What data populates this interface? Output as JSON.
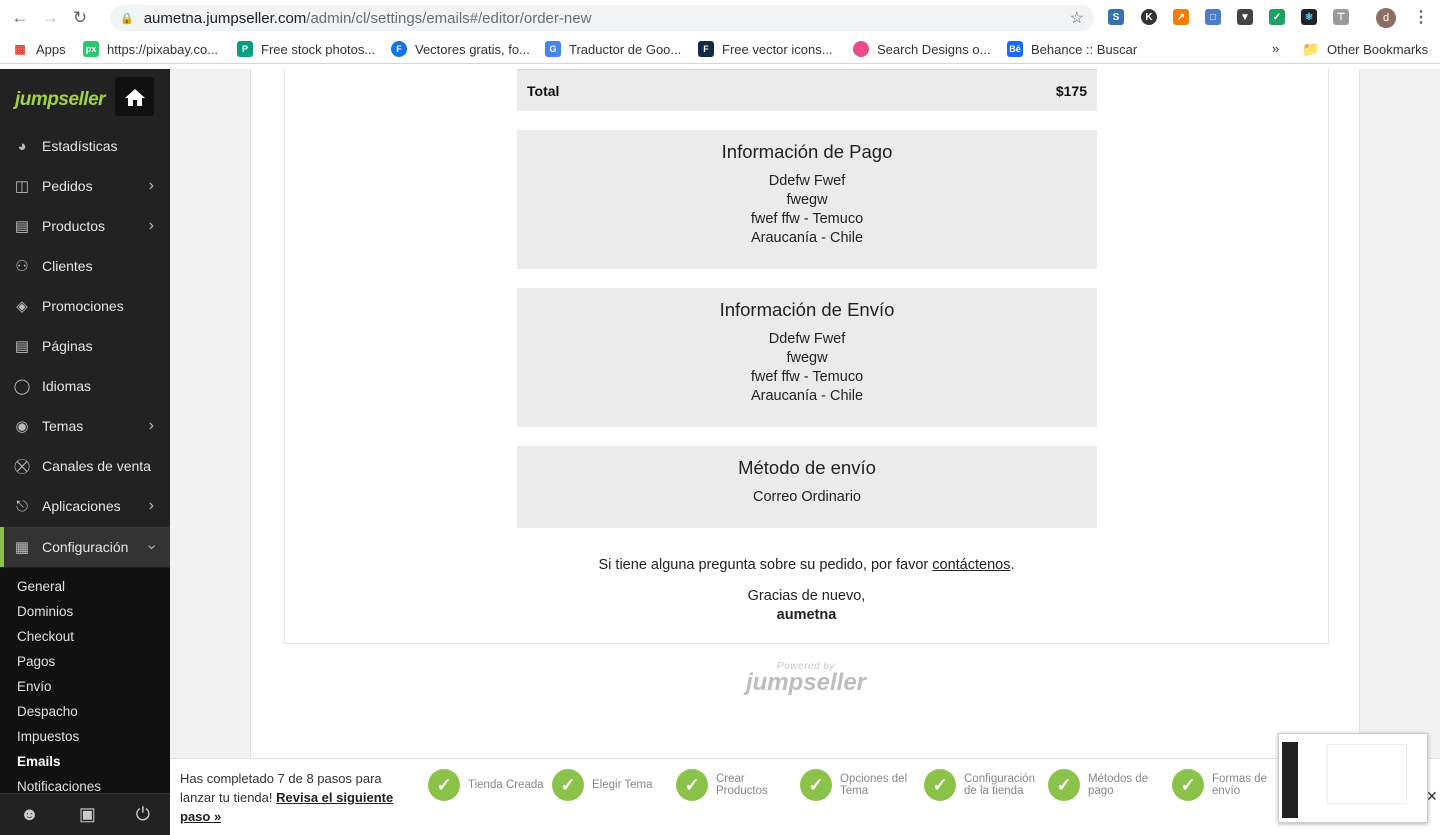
{
  "browser": {
    "url_host": "aumetna.jumpseller.com",
    "url_path": "/admin/cl/settings/emails#/editor/order-new",
    "avatar_letter": "d",
    "extension_badge": "0"
  },
  "bookmarks": [
    {
      "label": "Apps",
      "icon": "apps-grid-icon"
    },
    {
      "label": "https://pixabay.co...",
      "icon": "pixabay-icon"
    },
    {
      "label": "Free stock photos...",
      "icon": "pexels-icon"
    },
    {
      "label": "Vectores gratis, fo...",
      "icon": "freepik-icon"
    },
    {
      "label": "Traductor de Goo...",
      "icon": "google-translate-icon"
    },
    {
      "label": "Free vector icons...",
      "icon": "flaticon-icon"
    },
    {
      "label": "Search Designs o...",
      "icon": "dribbble-icon"
    },
    {
      "label": "Behance :: Buscar",
      "icon": "behance-icon"
    }
  ],
  "bookmarks_overflow": "»",
  "bookmarks_other": "Other Bookmarks",
  "sidebar": {
    "logo": "jumpseller",
    "items": [
      {
        "label": "Estadísticas",
        "icon": "dashboard-gauge-icon",
        "chevron": false
      },
      {
        "label": "Pedidos",
        "icon": "basket-icon",
        "chevron": true
      },
      {
        "label": "Productos",
        "icon": "box-icon",
        "chevron": true
      },
      {
        "label": "Clientes",
        "icon": "users-icon",
        "chevron": false
      },
      {
        "label": "Promociones",
        "icon": "tags-icon",
        "chevron": false
      },
      {
        "label": "Páginas",
        "icon": "page-icon",
        "chevron": false
      },
      {
        "label": "Idiomas",
        "icon": "globe-icon",
        "chevron": false
      },
      {
        "label": "Temas",
        "icon": "eye-icon",
        "chevron": true
      },
      {
        "label": "Canales de venta",
        "icon": "cart-icon",
        "chevron": false
      },
      {
        "label": "Aplicaciones",
        "icon": "plug-icon",
        "chevron": true
      },
      {
        "label": "Configuración",
        "icon": "settings-sliders-icon",
        "chevron": true
      }
    ],
    "sub_items": [
      "General",
      "Dominios",
      "Checkout",
      "Pagos",
      "Envío",
      "Despacho",
      "Impuestos",
      "Emails",
      "Notificaciones"
    ]
  },
  "email": {
    "total_label": "Total",
    "total_value": "$175",
    "payment": {
      "title": "Información de Pago",
      "lines": [
        "Ddefw Fwef",
        "fwegw",
        "fwef ffw - Temuco",
        "Araucanía - Chile"
      ]
    },
    "shipping": {
      "title": "Información de Envío",
      "lines": [
        "Ddefw Fwef",
        "fwegw",
        "fwef ffw - Temuco",
        "Araucanía - Chile"
      ]
    },
    "method": {
      "title": "Método de envío",
      "value": "Correo Ordinario"
    },
    "question_prefix": "Si tiene alguna pregunta sobre su pedido, por favor ",
    "question_link": "contáctenos",
    "question_suffix": ".",
    "thanks": "Gracias de nuevo,",
    "store": "aumetna",
    "powered_by": "Powered by",
    "powered_logo": "jumpseller"
  },
  "onboarding": {
    "text": "Has completado 7 de 8 pasos para lanzar tu tienda!",
    "link": "Revisa el siguiente paso »",
    "steps": [
      {
        "label": "Tienda Creada"
      },
      {
        "label": "Elegir Tema"
      },
      {
        "label": "Crear Productos"
      },
      {
        "label": "Opciones del Tema"
      },
      {
        "label": "Configuración de la tienda"
      },
      {
        "label": "Métodos de pago"
      },
      {
        "label": "Formas de envío"
      }
    ]
  },
  "colors": {
    "accent": "#8bc34a",
    "sidebar_bg": "#222222",
    "info_box_bg": "#ebebeb"
  }
}
